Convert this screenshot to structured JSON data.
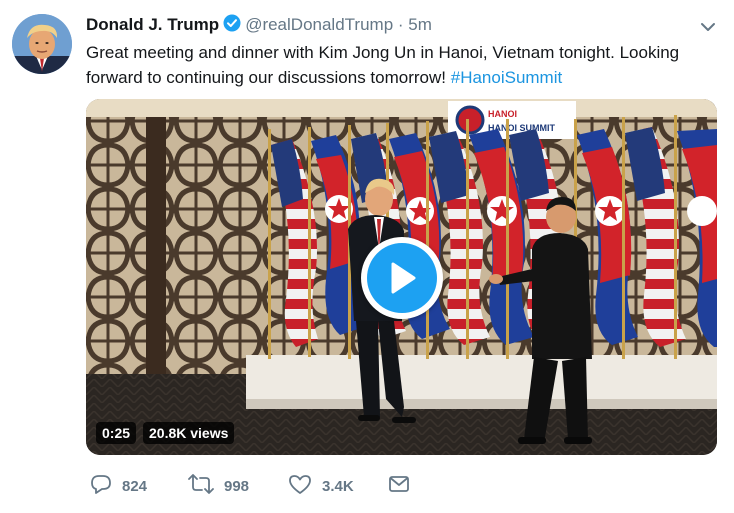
{
  "tweet": {
    "author_name": "Donald J. Trump",
    "handle": "@realDonaldTrump",
    "separator": "·",
    "time": "5m",
    "text_main": "Great meeting and dinner with Kim Jong Un in Hanoi, Vietnam tonight. Looking forward to continuing our discussions tomorrow! ",
    "hashtag": "#HanoiSummit",
    "icons": {
      "verified": "verified-badge-icon",
      "menu": "chevron-down-icon"
    }
  },
  "media": {
    "duration": "0:25",
    "views": "20.8K views",
    "banner_text": "HANOI SUMMIT",
    "play_icon": "play-icon"
  },
  "actions": {
    "reply_count": "824",
    "retweet_count": "998",
    "like_count": "3.4K",
    "icons": [
      "reply-icon",
      "retweet-icon",
      "like-icon",
      "message-icon"
    ]
  },
  "colors": {
    "accent": "#1da1f2",
    "text": "#14171a",
    "muted": "#657786",
    "link": "#1b95e0"
  }
}
